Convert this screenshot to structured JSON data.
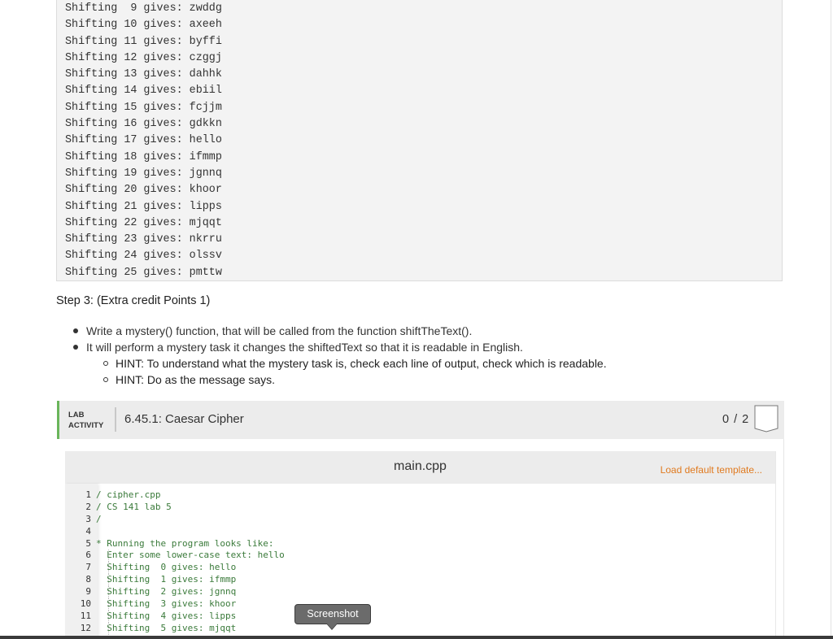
{
  "output_lines": [
    "Shifting  9 gives: zwddg",
    "Shifting 10 gives: axeeh",
    "Shifting 11 gives: byffi",
    "Shifting 12 gives: czggj",
    "Shifting 13 gives: dahhk",
    "Shifting 14 gives: ebiil",
    "Shifting 15 gives: fcjjm",
    "Shifting 16 gives: gdkkn",
    "Shifting 17 gives: hello",
    "Shifting 18 gives: ifmmp",
    "Shifting 19 gives: jgnnq",
    "Shifting 20 gives: khoor",
    "Shifting 21 gives: lipps",
    "Shifting 22 gives: mjqqt",
    "Shifting 23 gives: nkrru",
    "Shifting 24 gives: olssv",
    "Shifting 25 gives: pmttw"
  ],
  "step3": {
    "heading": "Step 3: (Extra credit Points 1)",
    "bullets": [
      "Write a mystery() function, that will be called from the function shiftTheText().",
      "It will perform a mystery task it changes the shiftedText so that it is readable in English."
    ],
    "sub_bullets": [
      "HINT: To understand what the mystery task is, check each line of output, check which is readable.",
      "HINT: Do as the message says."
    ]
  },
  "lab": {
    "tag_line1": "LAB",
    "tag_line2": "ACTIVITY",
    "title": "6.45.1: Caesar Cipher",
    "score": "0 / 2",
    "accent_color": "#6ab55b"
  },
  "editor": {
    "file_name": "main.cpp",
    "load_template_label": "Load default template...",
    "lines": [
      {
        "n": "1",
        "text": "/ cipher.cpp"
      },
      {
        "n": "2",
        "text": "/ CS 141 lab 5"
      },
      {
        "n": "3",
        "text": "/"
      },
      {
        "n": "4",
        "text": ""
      },
      {
        "n": "5",
        "text": "* Running the program looks like:"
      },
      {
        "n": "6",
        "text": "  Enter some lower-case text: hello"
      },
      {
        "n": "7",
        "text": "  Shifting  0 gives: hello"
      },
      {
        "n": "8",
        "text": "  Shifting  1 gives: ifmmp"
      },
      {
        "n": "9",
        "text": "  Shifting  2 gives: jgnnq"
      },
      {
        "n": "10",
        "text": "  Shifting  3 gives: khoor"
      },
      {
        "n": "11",
        "text": "  Shifting  4 gives: lipps"
      },
      {
        "n": "12",
        "text": "  Shifting  5 gives: mjqqt"
      }
    ]
  },
  "tooltip": {
    "label": "Screenshot"
  }
}
